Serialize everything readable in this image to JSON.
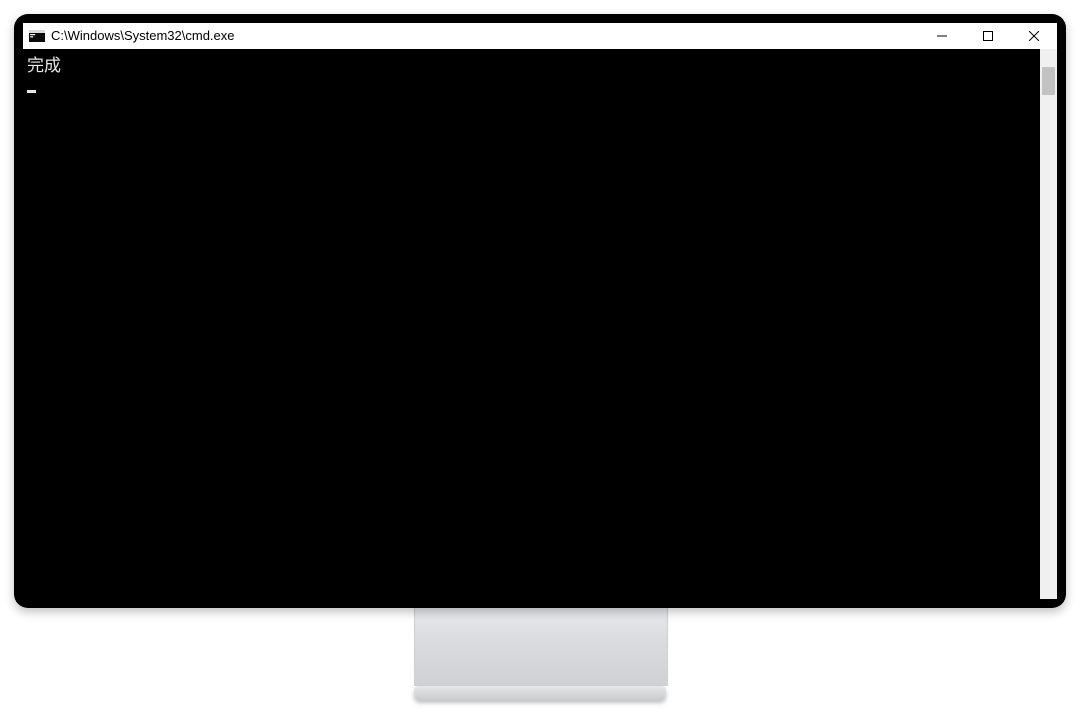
{
  "window": {
    "title": "C:\\Windows\\System32\\cmd.exe"
  },
  "console": {
    "lines": [
      "完成"
    ]
  }
}
